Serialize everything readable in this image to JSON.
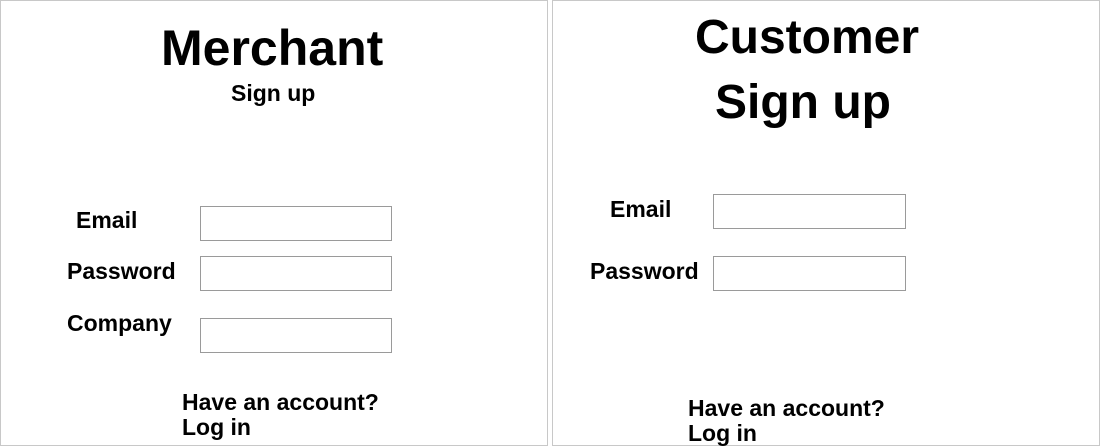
{
  "merchant": {
    "title": "Merchant",
    "subtitle": "Sign up",
    "email_label": "Email",
    "password_label": "Password",
    "company_label": "Company",
    "email_value": "",
    "password_value": "",
    "company_value": "",
    "have_account": "Have an account?",
    "login_link": "Log in"
  },
  "customer": {
    "title": "Customer",
    "subtitle": "Sign up",
    "email_label": "Email",
    "password_label": "Password",
    "email_value": "",
    "password_value": "",
    "have_account": "Have an account?",
    "login_link": "Log in"
  }
}
